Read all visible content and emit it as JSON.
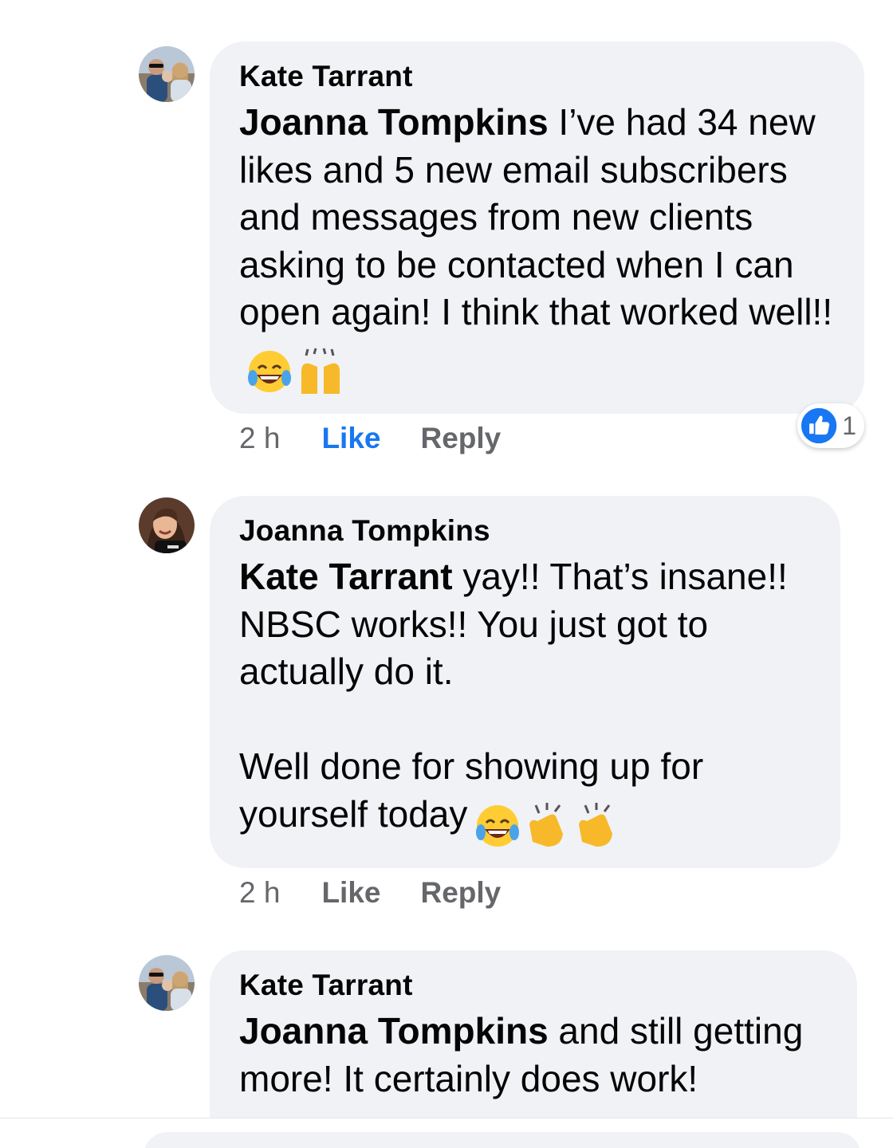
{
  "comments": [
    {
      "author": "Kate Tarrant",
      "mention": "Joanna Tompkins",
      "text": " I’ve had 34 new likes and 5 new email subscribers and messages from new clients asking to be contacted when I can open again! I think that worked well!!",
      "emojis": [
        "face-with-tears-of-joy",
        "raising-hands"
      ],
      "time": "2 h",
      "like_label": "Like",
      "reply_label": "Reply",
      "reaction_count": "1",
      "liked": true
    },
    {
      "author": "Joanna Tompkins",
      "mention": "Kate Tarrant",
      "text": " yay!! That’s insane!! NBSC works!! You just got to actually do it.\n\nWell done for showing up for yourself today",
      "emojis": [
        "face-with-tears-of-joy",
        "clapping-hands",
        "clapping-hands"
      ],
      "time": "2 h",
      "like_label": "Like",
      "reply_label": "Reply"
    },
    {
      "author": "Kate Tarrant",
      "mention": "Joanna Tompkins",
      "text": " and still getting more! It certainly does work!"
    }
  ],
  "colors": {
    "bubble": "#f0f2f5",
    "meta": "#65676b",
    "like_active": "#1877f2"
  }
}
